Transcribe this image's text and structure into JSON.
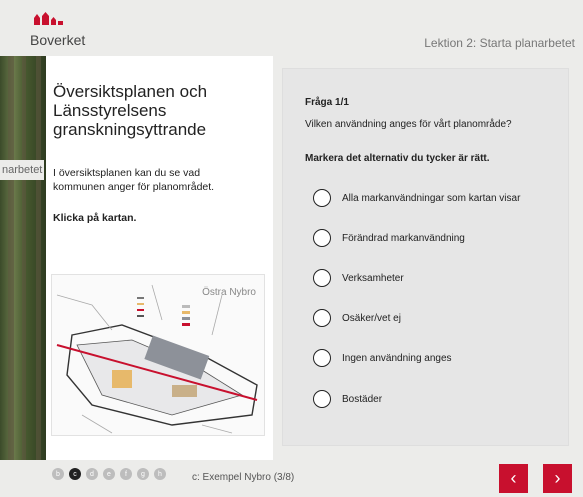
{
  "header": {
    "logo_text": "Boverket",
    "lesson_title": "Lektion 2: Starta planarbetet"
  },
  "background": {
    "partial_label": "narbetet"
  },
  "left_panel": {
    "title": "Översiktsplanen och Länsstyrelsens granskningsyttrande",
    "body": "I översiktsplanen kan du se vad kommunen anger för planområdet.",
    "instruction": "Klicka på kartan.",
    "map_label": "Östra Nybro"
  },
  "quiz": {
    "question_number": "Fråga 1/1",
    "question": "Vilken användning anges för vårt planområde?",
    "instruction": "Markera det alternativ du tycker är rätt.",
    "options": [
      "Alla markanvändningar som kartan visar",
      "Förändrad markanvändning",
      "Verksamheter",
      "Osäker/vet ej",
      "Ingen användning anges",
      "Bostäder"
    ]
  },
  "footer": {
    "dots": [
      "b",
      "c",
      "d",
      "e",
      "f",
      "g",
      "h"
    ],
    "active_dot": "c",
    "page_label": "c: Exempel Nybro (3/8)",
    "prev_icon": "chevron-left-icon",
    "next_icon": "chevron-right-icon"
  },
  "colors": {
    "accent": "#c8102e",
    "panel": "#ececea",
    "quiz_bg": "#e6e6e6"
  }
}
